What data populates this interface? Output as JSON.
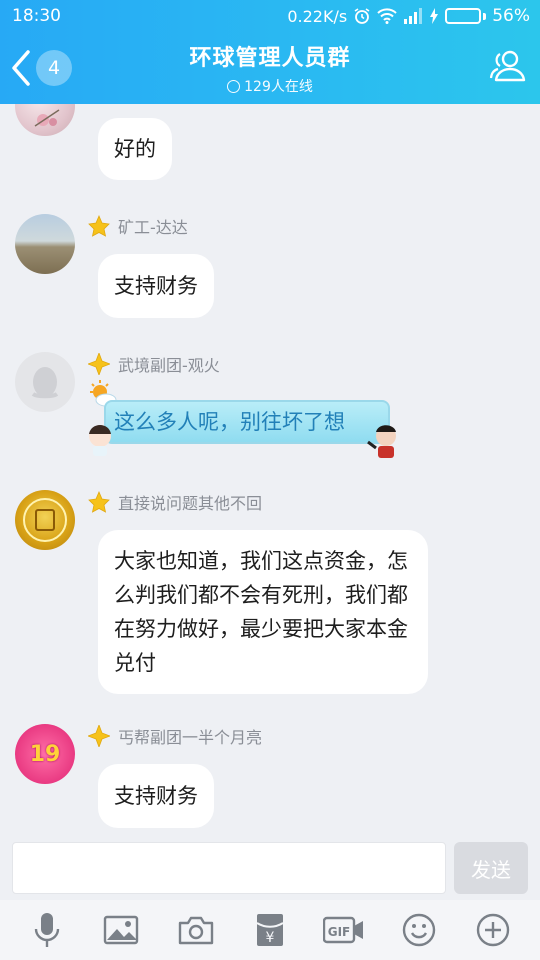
{
  "status_bar": {
    "time": "18:30",
    "network_speed": "0.22K/s",
    "battery": "56%",
    "battery_level": 0.56
  },
  "header": {
    "back_count": "4",
    "title": "环球管理人员群",
    "online": "129人在线"
  },
  "messages": [
    {
      "name": "",
      "text": "好的"
    },
    {
      "name": "矿工-达达",
      "text": "支持财务"
    },
    {
      "name": "武境副团-观火",
      "text": "这么多人呢，别往坏了想"
    },
    {
      "name": "直接说问题其他不回",
      "text": "大家也知道，我们这点资金，怎么判我们都不会有死刑，我们都在努力做好，最少要把大家本金兑付"
    },
    {
      "name": "丐帮副团一半个月亮",
      "avatar_text": "19",
      "text": "支持财务"
    }
  ],
  "composer": {
    "send_label": "发送",
    "input_value": ""
  },
  "colors": {
    "header_start": "#27a9f5",
    "header_end": "#2cc6ec",
    "background": "#eef0f4",
    "badge_gold": "#f6c21a"
  },
  "toolbar_icons": [
    "microphone-icon",
    "image-icon",
    "camera-icon",
    "red-packet-icon",
    "gif-icon",
    "emoji-icon",
    "plus-icon"
  ]
}
